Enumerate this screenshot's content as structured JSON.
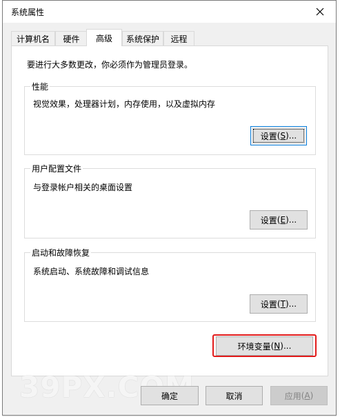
{
  "window": {
    "title": "系统属性"
  },
  "tabs": [
    {
      "label": "计算机名",
      "active": false
    },
    {
      "label": "硬件",
      "active": false
    },
    {
      "label": "高级",
      "active": true
    },
    {
      "label": "系统保护",
      "active": false
    },
    {
      "label": "远程",
      "active": false
    }
  ],
  "panel": {
    "intro": "要进行大多数更改，你必须作为管理员登录。",
    "groups": [
      {
        "title": "性能",
        "description": "视觉效果，处理器计划，内存使用，以及虚拟内存",
        "button": {
          "label": "设置",
          "hotkey": "S",
          "suffix": ")..."
        }
      },
      {
        "title": "用户配置文件",
        "description": "与登录帐户相关的桌面设置",
        "button": {
          "label": "设置",
          "hotkey": "E",
          "suffix": ")..."
        }
      },
      {
        "title": "启动和故障恢复",
        "description": "系统启动、系统故障和调试信息",
        "button": {
          "label": "设置",
          "hotkey": "T",
          "suffix": ")..."
        }
      }
    ],
    "env_button": {
      "label": "环境变量",
      "hotkey": "N",
      "suffix": ")..."
    }
  },
  "footer": {
    "ok": "确定",
    "cancel": "取消",
    "apply": {
      "label": "应用",
      "hotkey": "A",
      "suffix": ")"
    }
  },
  "watermark": "39PX.COM",
  "colors": {
    "focus": "#0078d7",
    "highlight": "#e21a1a",
    "button_face": "#e1e1e1",
    "disabled_text": "#838383"
  },
  "icons": {
    "close": "close-icon"
  }
}
